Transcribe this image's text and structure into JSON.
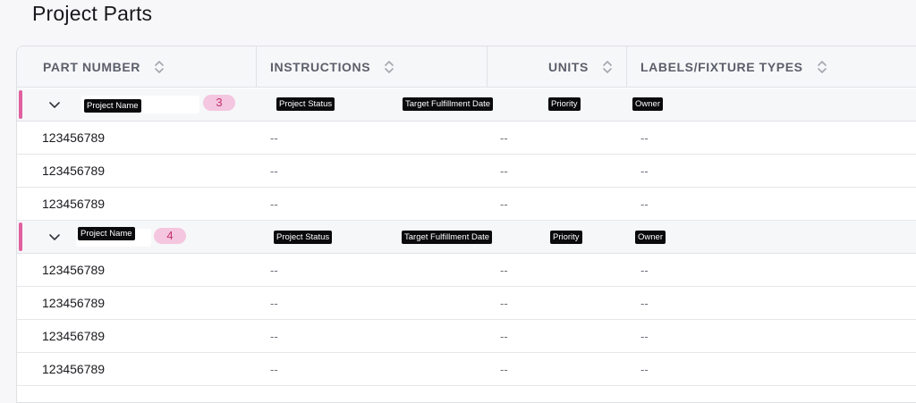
{
  "page": {
    "title": "Project Parts"
  },
  "columns": [
    {
      "key": "part_number",
      "label": "PART NUMBER"
    },
    {
      "key": "instructions",
      "label": "INSTRUCTIONS"
    },
    {
      "key": "units",
      "label": "UNITS"
    },
    {
      "key": "labels",
      "label": "LABELS/FIXTURE TYPES"
    }
  ],
  "groups": [
    {
      "name_tag": "Project Name",
      "count": "3",
      "status_tag": "Project Status",
      "date_tag": "Target Fulfillment Date",
      "priority_tag": "Priority",
      "owner_tag": "Owner",
      "rows": [
        {
          "part_number": "123456789",
          "instructions": "--",
          "units": "--",
          "labels": "--"
        },
        {
          "part_number": "123456789",
          "instructions": "--",
          "units": "--",
          "labels": "--"
        },
        {
          "part_number": "123456789",
          "instructions": "--",
          "units": "--",
          "labels": "--"
        }
      ]
    },
    {
      "name_tag": "Project Name",
      "count": "4",
      "status_tag": "Project Status",
      "date_tag": "Target Fulfillment Date",
      "priority_tag": "Priority",
      "owner_tag": "Owner",
      "rows": [
        {
          "part_number": "123456789",
          "instructions": "--",
          "units": "--",
          "labels": "--"
        },
        {
          "part_number": "123456789",
          "instructions": "--",
          "units": "--",
          "labels": "--"
        },
        {
          "part_number": "123456789",
          "instructions": "--",
          "units": "--",
          "labels": "--"
        },
        {
          "part_number": "123456789",
          "instructions": "--",
          "units": "--",
          "labels": "--"
        }
      ]
    }
  ],
  "icons": {
    "sort": "sort-icon",
    "expand": "chevron-down-icon"
  },
  "colors": {
    "accent": "#e0609f",
    "badge_bg": "#f4c6df",
    "badge_text": "#c4336f",
    "tag_bg": "#0a0a0c"
  }
}
